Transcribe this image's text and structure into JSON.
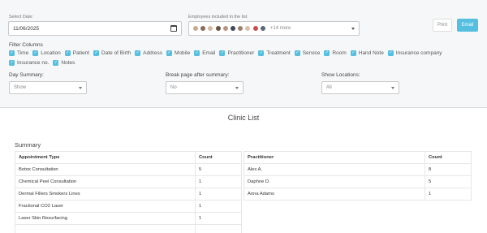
{
  "controls": {
    "date_label": "Select Date:",
    "date_value": "11/06/2025",
    "employees_label": "Employees included in the list",
    "employees_more": "+14 more",
    "avatar_colors": [
      "#c9a98c",
      "#8a6b5a",
      "#d9b8a0",
      "#6b5140",
      "#b89580",
      "#3e4a5a",
      "#a0806a",
      "#d8c0ad",
      "#cc4b4b",
      "#5a6a7a"
    ],
    "print_label": "Print",
    "email_label": "Email"
  },
  "filter": {
    "title": "Filter Columns",
    "columns": [
      "Time",
      "Location",
      "Patient",
      "Date of Birth",
      "Address",
      "Mobile",
      "Email",
      "Practitioner",
      "Treatment",
      "Service",
      "Room",
      "Hand Note",
      "Insurance company",
      "Insurance no.",
      "Notes"
    ]
  },
  "selects": {
    "day_summary": {
      "label": "Day Summary:",
      "value": "Show"
    },
    "break_page": {
      "label": "Break page after summary:",
      "value": "No"
    },
    "show_locations": {
      "label": "Show Locations:",
      "value": "All"
    }
  },
  "report": {
    "title": "Clinic List",
    "summary_label": "Summary",
    "appointments": {
      "headers": [
        "Appointment Type",
        "Count"
      ],
      "rows": [
        [
          "Botox Consultation",
          "5"
        ],
        [
          "Chemical Peel Consultation",
          "1"
        ],
        [
          "Dermal Fillers Smokers Lines",
          "1"
        ],
        [
          "Fractional CO2 Laser",
          "1"
        ],
        [
          "Laser Skin Resurfacing",
          "1"
        ],
        [
          "",
          ""
        ]
      ]
    },
    "practitioners": {
      "headers": [
        "Practitioner",
        "Count"
      ],
      "rows": [
        [
          "Alex A.",
          "8"
        ],
        [
          "Daphne D.",
          "5"
        ],
        [
          "Anna Adams",
          "1"
        ]
      ]
    }
  },
  "colors": {
    "accent": "#56bfe0",
    "panel": "#f6f7f8"
  }
}
